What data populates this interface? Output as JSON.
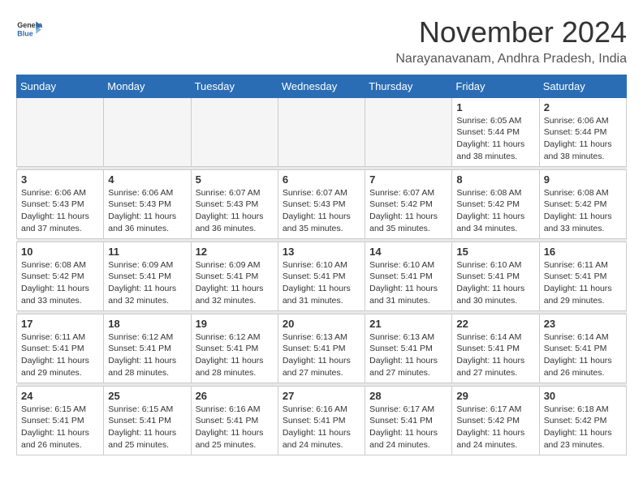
{
  "header": {
    "logo_line1": "General",
    "logo_line2": "Blue",
    "title": "November 2024",
    "subtitle": "Narayanavanam, Andhra Pradesh, India"
  },
  "calendar": {
    "days_of_week": [
      "Sunday",
      "Monday",
      "Tuesday",
      "Wednesday",
      "Thursday",
      "Friday",
      "Saturday"
    ],
    "weeks": [
      [
        {
          "day": "",
          "info": ""
        },
        {
          "day": "",
          "info": ""
        },
        {
          "day": "",
          "info": ""
        },
        {
          "day": "",
          "info": ""
        },
        {
          "day": "",
          "info": ""
        },
        {
          "day": "1",
          "info": "Sunrise: 6:05 AM\nSunset: 5:44 PM\nDaylight: 11 hours\nand 38 minutes."
        },
        {
          "day": "2",
          "info": "Sunrise: 6:06 AM\nSunset: 5:44 PM\nDaylight: 11 hours\nand 38 minutes."
        }
      ],
      [
        {
          "day": "3",
          "info": "Sunrise: 6:06 AM\nSunset: 5:43 PM\nDaylight: 11 hours\nand 37 minutes."
        },
        {
          "day": "4",
          "info": "Sunrise: 6:06 AM\nSunset: 5:43 PM\nDaylight: 11 hours\nand 36 minutes."
        },
        {
          "day": "5",
          "info": "Sunrise: 6:07 AM\nSunset: 5:43 PM\nDaylight: 11 hours\nand 36 minutes."
        },
        {
          "day": "6",
          "info": "Sunrise: 6:07 AM\nSunset: 5:43 PM\nDaylight: 11 hours\nand 35 minutes."
        },
        {
          "day": "7",
          "info": "Sunrise: 6:07 AM\nSunset: 5:42 PM\nDaylight: 11 hours\nand 35 minutes."
        },
        {
          "day": "8",
          "info": "Sunrise: 6:08 AM\nSunset: 5:42 PM\nDaylight: 11 hours\nand 34 minutes."
        },
        {
          "day": "9",
          "info": "Sunrise: 6:08 AM\nSunset: 5:42 PM\nDaylight: 11 hours\nand 33 minutes."
        }
      ],
      [
        {
          "day": "10",
          "info": "Sunrise: 6:08 AM\nSunset: 5:42 PM\nDaylight: 11 hours\nand 33 minutes."
        },
        {
          "day": "11",
          "info": "Sunrise: 6:09 AM\nSunset: 5:41 PM\nDaylight: 11 hours\nand 32 minutes."
        },
        {
          "day": "12",
          "info": "Sunrise: 6:09 AM\nSunset: 5:41 PM\nDaylight: 11 hours\nand 32 minutes."
        },
        {
          "day": "13",
          "info": "Sunrise: 6:10 AM\nSunset: 5:41 PM\nDaylight: 11 hours\nand 31 minutes."
        },
        {
          "day": "14",
          "info": "Sunrise: 6:10 AM\nSunset: 5:41 PM\nDaylight: 11 hours\nand 31 minutes."
        },
        {
          "day": "15",
          "info": "Sunrise: 6:10 AM\nSunset: 5:41 PM\nDaylight: 11 hours\nand 30 minutes."
        },
        {
          "day": "16",
          "info": "Sunrise: 6:11 AM\nSunset: 5:41 PM\nDaylight: 11 hours\nand 29 minutes."
        }
      ],
      [
        {
          "day": "17",
          "info": "Sunrise: 6:11 AM\nSunset: 5:41 PM\nDaylight: 11 hours\nand 29 minutes."
        },
        {
          "day": "18",
          "info": "Sunrise: 6:12 AM\nSunset: 5:41 PM\nDaylight: 11 hours\nand 28 minutes."
        },
        {
          "day": "19",
          "info": "Sunrise: 6:12 AM\nSunset: 5:41 PM\nDaylight: 11 hours\nand 28 minutes."
        },
        {
          "day": "20",
          "info": "Sunrise: 6:13 AM\nSunset: 5:41 PM\nDaylight: 11 hours\nand 27 minutes."
        },
        {
          "day": "21",
          "info": "Sunrise: 6:13 AM\nSunset: 5:41 PM\nDaylight: 11 hours\nand 27 minutes."
        },
        {
          "day": "22",
          "info": "Sunrise: 6:14 AM\nSunset: 5:41 PM\nDaylight: 11 hours\nand 27 minutes."
        },
        {
          "day": "23",
          "info": "Sunrise: 6:14 AM\nSunset: 5:41 PM\nDaylight: 11 hours\nand 26 minutes."
        }
      ],
      [
        {
          "day": "24",
          "info": "Sunrise: 6:15 AM\nSunset: 5:41 PM\nDaylight: 11 hours\nand 26 minutes."
        },
        {
          "day": "25",
          "info": "Sunrise: 6:15 AM\nSunset: 5:41 PM\nDaylight: 11 hours\nand 25 minutes."
        },
        {
          "day": "26",
          "info": "Sunrise: 6:16 AM\nSunset: 5:41 PM\nDaylight: 11 hours\nand 25 minutes."
        },
        {
          "day": "27",
          "info": "Sunrise: 6:16 AM\nSunset: 5:41 PM\nDaylight: 11 hours\nand 24 minutes."
        },
        {
          "day": "28",
          "info": "Sunrise: 6:17 AM\nSunset: 5:41 PM\nDaylight: 11 hours\nand 24 minutes."
        },
        {
          "day": "29",
          "info": "Sunrise: 6:17 AM\nSunset: 5:42 PM\nDaylight: 11 hours\nand 24 minutes."
        },
        {
          "day": "30",
          "info": "Sunrise: 6:18 AM\nSunset: 5:42 PM\nDaylight: 11 hours\nand 23 minutes."
        }
      ]
    ]
  }
}
